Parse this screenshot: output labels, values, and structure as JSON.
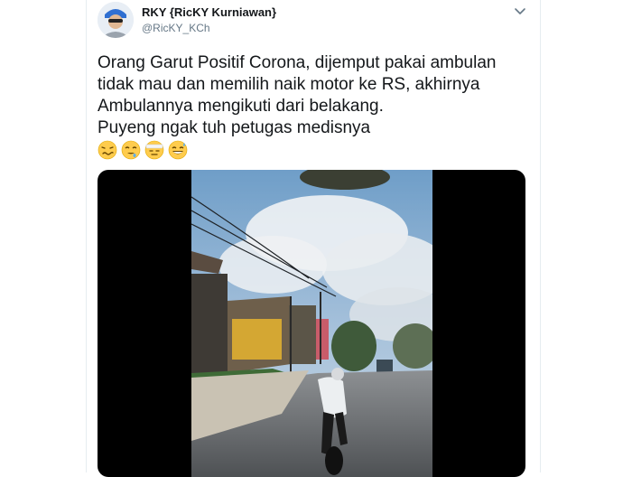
{
  "tweet": {
    "display_name": "RKY {RicKY Kurniawan}",
    "handle": "@RicKY_KCh",
    "lines": [
      "Orang Garut Positif Corona, dijemput pakai ambulan",
      "tidak mau dan memilih naik motor ke RS, akhirnya",
      "Ambulannya mengikuti dari belakang.",
      "Puyeng ngak tuh  petugas medisnya"
    ],
    "emojis": [
      "woozy-face-icon",
      "drooling-face-icon",
      "bandage-face-icon",
      "grinning-sweat-face-icon"
    ]
  },
  "colors": {
    "text": "#14171a",
    "secondary": "#657786",
    "border": "#e6ecf0"
  }
}
